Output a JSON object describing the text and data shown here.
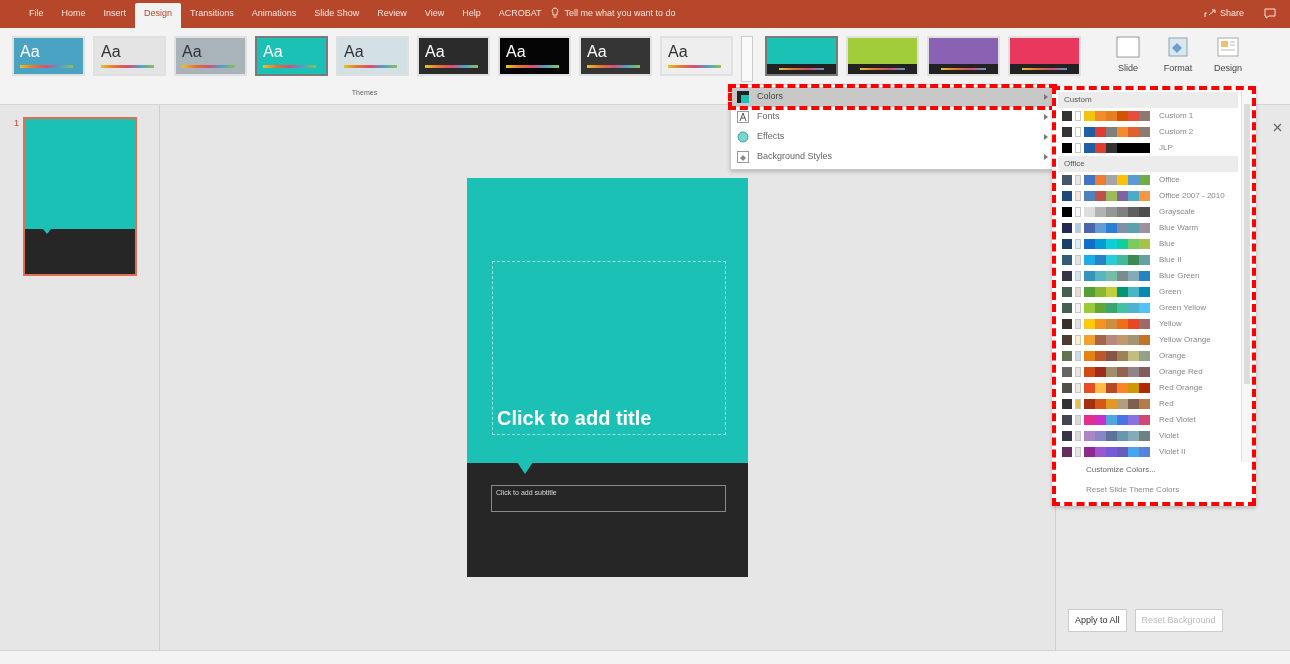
{
  "ribbon_tabs": [
    {
      "label": "File",
      "selected": false
    },
    {
      "label": "Home",
      "selected": false
    },
    {
      "label": "Insert",
      "selected": false
    },
    {
      "label": "Design",
      "selected": true
    },
    {
      "label": "Transitions",
      "selected": false
    },
    {
      "label": "Animations",
      "selected": false
    },
    {
      "label": "Slide Show",
      "selected": false
    },
    {
      "label": "Review",
      "selected": false
    },
    {
      "label": "View",
      "selected": false
    },
    {
      "label": "Help",
      "selected": false
    },
    {
      "label": "ACROBAT",
      "selected": false
    }
  ],
  "tell_me": {
    "placeholder": "Tell me what you want to do"
  },
  "share": "Share",
  "themes": {
    "label": "Themes",
    "items": [
      {
        "text": "Aa",
        "color": "#4ba3c3",
        "selected": false
      },
      {
        "text": "Aa",
        "color": "#e4e4e4",
        "selected": false
      },
      {
        "text": "Aa",
        "color": "#a9b3ba",
        "selected": false
      },
      {
        "text": "Aa",
        "color": "#1bc1b5",
        "selected": true
      },
      {
        "text": "Aa",
        "color": "#d3e0e6",
        "selected": false
      },
      {
        "text": "Aa",
        "color": "#2b2b2b",
        "selected": false
      },
      {
        "text": "Aa",
        "color": "#050505",
        "selected": false
      },
      {
        "text": "Aa",
        "color": "#353535",
        "selected": false
      },
      {
        "text": "Aa",
        "color": "#eeeeee",
        "selected": false
      }
    ]
  },
  "variants": [
    {
      "color": "#1bc1b5",
      "selected": true
    },
    {
      "color": "#a2cd3a",
      "selected": false
    },
    {
      "color": "#8a62b4",
      "selected": false
    },
    {
      "color": "#e8385e",
      "selected": false
    }
  ],
  "commands": [
    {
      "label": "Slide",
      "kind": "size"
    },
    {
      "label": "Format",
      "kind": "background"
    },
    {
      "label": "Design",
      "kind": "ideas"
    }
  ],
  "variants_menu": [
    {
      "label": "Colors",
      "kind": "colors",
      "selected": true,
      "highlighted": true
    },
    {
      "label": "Fonts",
      "kind": "fonts",
      "selected": false,
      "highlighted": false
    },
    {
      "label": "Effects",
      "kind": "effects",
      "selected": false,
      "highlighted": false
    },
    {
      "label": "Background Styles",
      "kind": "background",
      "selected": false,
      "highlighted": false
    }
  ],
  "colors_gallery": {
    "highlighted": true,
    "sections": [
      {
        "title": "Custom",
        "schemes": [
          {
            "name": "Custom 1",
            "swatches": [
              {
                "color": "#333333"
              },
              {
                "color": "#ffffff"
              },
              {
                "color": "#f2c40f"
              },
              {
                "color": "#f28c28"
              },
              {
                "color": "#e67e22"
              },
              {
                "color": "#d35400"
              },
              {
                "color": "#e74c3c"
              },
              {
                "color": "#8c7b75"
              }
            ]
          },
          {
            "name": "Custom 2",
            "swatches": [
              {
                "color": "#333333"
              },
              {
                "color": "#ffffff"
              },
              {
                "color": "#1f5fa8"
              },
              {
                "color": "#e03c31"
              },
              {
                "color": "#7f7f7f"
              },
              {
                "color": "#f28c28"
              },
              {
                "color": "#e06030"
              },
              {
                "color": "#8c7b75"
              }
            ]
          },
          {
            "name": "JLP",
            "swatches": [
              {
                "color": "#000000"
              },
              {
                "color": "#ffffff"
              },
              {
                "color": "#1f5fa8"
              },
              {
                "color": "#e03c31"
              },
              {
                "color": "#333333"
              },
              {
                "color": "#000000"
              },
              {
                "color": "#000000"
              },
              {
                "color": "#000000"
              }
            ]
          }
        ]
      },
      {
        "title": "Office",
        "schemes": [
          {
            "name": "Office",
            "swatches": [
              {
                "color": "#44546a"
              },
              {
                "color": "#e7e6e6"
              },
              {
                "color": "#4472c4"
              },
              {
                "color": "#ed7d31"
              },
              {
                "color": "#a5a5a5"
              },
              {
                "color": "#ffc000"
              },
              {
                "color": "#5b9bd5"
              },
              {
                "color": "#70ad47"
              }
            ]
          },
          {
            "name": "Office 2007 - 2010",
            "swatches": [
              {
                "color": "#1f497d"
              },
              {
                "color": "#eeece1"
              },
              {
                "color": "#4f81bd"
              },
              {
                "color": "#c0504d"
              },
              {
                "color": "#9bbb59"
              },
              {
                "color": "#8064a2"
              },
              {
                "color": "#4bacc6"
              },
              {
                "color": "#f79646"
              }
            ]
          },
          {
            "name": "Grayscale",
            "swatches": [
              {
                "color": "#000000"
              },
              {
                "color": "#f8f8f8"
              },
              {
                "color": "#dddddd"
              },
              {
                "color": "#b2b2b2"
              },
              {
                "color": "#969696"
              },
              {
                "color": "#808080"
              },
              {
                "color": "#5f5f5f"
              },
              {
                "color": "#4d4d4d"
              }
            ]
          },
          {
            "name": "Blue Warm",
            "swatches": [
              {
                "color": "#242852"
              },
              {
                "color": "#acccea"
              },
              {
                "color": "#4a66ac"
              },
              {
                "color": "#629dd1"
              },
              {
                "color": "#297fd5"
              },
              {
                "color": "#7f8fa9"
              },
              {
                "color": "#5aa2ae"
              },
              {
                "color": "#9d90a0"
              }
            ]
          },
          {
            "name": "Blue",
            "swatches": [
              {
                "color": "#17406d"
              },
              {
                "color": "#dbeff9"
              },
              {
                "color": "#0f6fc6"
              },
              {
                "color": "#009dd9"
              },
              {
                "color": "#0bd0d9"
              },
              {
                "color": "#10cf9b"
              },
              {
                "color": "#7cca62"
              },
              {
                "color": "#a5c249"
              }
            ]
          },
          {
            "name": "Blue II",
            "swatches": [
              {
                "color": "#335b74"
              },
              {
                "color": "#dfe3e5"
              },
              {
                "color": "#1cade4"
              },
              {
                "color": "#2683c6"
              },
              {
                "color": "#27ced7"
              },
              {
                "color": "#42ba97"
              },
              {
                "color": "#3e8853"
              },
              {
                "color": "#62a39f"
              }
            ]
          },
          {
            "name": "Blue Green",
            "swatches": [
              {
                "color": "#373545"
              },
              {
                "color": "#cee7ec"
              },
              {
                "color": "#3494ba"
              },
              {
                "color": "#58b6c0"
              },
              {
                "color": "#75bda7"
              },
              {
                "color": "#7a8c8e"
              },
              {
                "color": "#84acb6"
              },
              {
                "color": "#2683c6"
              }
            ]
          },
          {
            "name": "Green",
            "swatches": [
              {
                "color": "#455f51"
              },
              {
                "color": "#e3ded1"
              },
              {
                "color": "#549e39"
              },
              {
                "color": "#8ab833"
              },
              {
                "color": "#c0cf3a"
              },
              {
                "color": "#029676"
              },
              {
                "color": "#4ab5c4"
              },
              {
                "color": "#0989b1"
              }
            ]
          },
          {
            "name": "Green Yellow",
            "swatches": [
              {
                "color": "#455f51"
              },
              {
                "color": "#f2f2f2"
              },
              {
                "color": "#99cb38"
              },
              {
                "color": "#63a537"
              },
              {
                "color": "#37a76f"
              },
              {
                "color": "#44c1a3"
              },
              {
                "color": "#4eb3cf"
              },
              {
                "color": "#51c3f9"
              }
            ]
          },
          {
            "name": "Yellow",
            "swatches": [
              {
                "color": "#39302a"
              },
              {
                "color": "#e5dedb"
              },
              {
                "color": "#ffca08"
              },
              {
                "color": "#f8931d"
              },
              {
                "color": "#ce8d3e"
              },
              {
                "color": "#ec7016"
              },
              {
                "color": "#e64823"
              },
              {
                "color": "#9c6a6a"
              }
            ]
          },
          {
            "name": "Yellow Orange",
            "swatches": [
              {
                "color": "#4e3b30"
              },
              {
                "color": "#fbeec9"
              },
              {
                "color": "#f0a22e"
              },
              {
                "color": "#a5644e"
              },
              {
                "color": "#b58b80"
              },
              {
                "color": "#c3986d"
              },
              {
                "color": "#a19574"
              },
              {
                "color": "#c17529"
              }
            ]
          },
          {
            "name": "Orange",
            "swatches": [
              {
                "color": "#637052"
              },
              {
                "color": "#ccddea"
              },
              {
                "color": "#e48312"
              },
              {
                "color": "#bd582c"
              },
              {
                "color": "#865640"
              },
              {
                "color": "#9b8357"
              },
              {
                "color": "#c2bc80"
              },
              {
                "color": "#94a088"
              }
            ]
          },
          {
            "name": "Orange Red",
            "swatches": [
              {
                "color": "#696464"
              },
              {
                "color": "#e9e5dc"
              },
              {
                "color": "#d34817"
              },
              {
                "color": "#9b2d1f"
              },
              {
                "color": "#a28e6a"
              },
              {
                "color": "#956251"
              },
              {
                "color": "#918485"
              },
              {
                "color": "#855d5d"
              }
            ]
          },
          {
            "name": "Red Orange",
            "swatches": [
              {
                "color": "#505046"
              },
              {
                "color": "#eeece1"
              },
              {
                "color": "#e84c22"
              },
              {
                "color": "#ffbd47"
              },
              {
                "color": "#b64926"
              },
              {
                "color": "#ff8427"
              },
              {
                "color": "#cc9900"
              },
              {
                "color": "#b22600"
              }
            ]
          },
          {
            "name": "Red",
            "swatches": [
              {
                "color": "#323232"
              },
              {
                "color": "#e5c243"
              },
              {
                "color": "#a5300f"
              },
              {
                "color": "#d55816"
              },
              {
                "color": "#e19825"
              },
              {
                "color": "#b19c7d"
              },
              {
                "color": "#7f5f52"
              },
              {
                "color": "#b27d49"
              }
            ]
          },
          {
            "name": "Red Violet",
            "swatches": [
              {
                "color": "#454551"
              },
              {
                "color": "#d8d9dc"
              },
              {
                "color": "#e32d91"
              },
              {
                "color": "#c830cc"
              },
              {
                "color": "#4ea6dc"
              },
              {
                "color": "#4775e7"
              },
              {
                "color": "#8971e1"
              },
              {
                "color": "#d54773"
              }
            ]
          },
          {
            "name": "Violet",
            "swatches": [
              {
                "color": "#373545"
              },
              {
                "color": "#dcd8dc"
              },
              {
                "color": "#ad84c6"
              },
              {
                "color": "#8784c7"
              },
              {
                "color": "#5d739a"
              },
              {
                "color": "#6997af"
              },
              {
                "color": "#84acb6"
              },
              {
                "color": "#6f8183"
              }
            ]
          },
          {
            "name": "Violet II",
            "swatches": [
              {
                "color": "#632e62"
              },
              {
                "color": "#eae5eb"
              },
              {
                "color": "#92278f"
              },
              {
                "color": "#9b57d3"
              },
              {
                "color": "#755dd9"
              },
              {
                "color": "#665eb8"
              },
              {
                "color": "#45a5ed"
              },
              {
                "color": "#5982db"
              }
            ]
          }
        ]
      }
    ],
    "footer": [
      {
        "label": "Customize Colors...",
        "disabled": false
      },
      {
        "label": "Reset Slide Theme Colors",
        "disabled": true
      }
    ]
  },
  "slides_panel": [
    {
      "number": "1",
      "selected": true
    }
  ],
  "slide": {
    "title": "Click to add title",
    "subtitle": "Click to add subtitle",
    "color": "#1bc1b5"
  },
  "format_pane": {
    "buttons": [
      {
        "label": "Apply to All",
        "disabled": false
      },
      {
        "label": "Reset Background",
        "disabled": true
      }
    ]
  }
}
